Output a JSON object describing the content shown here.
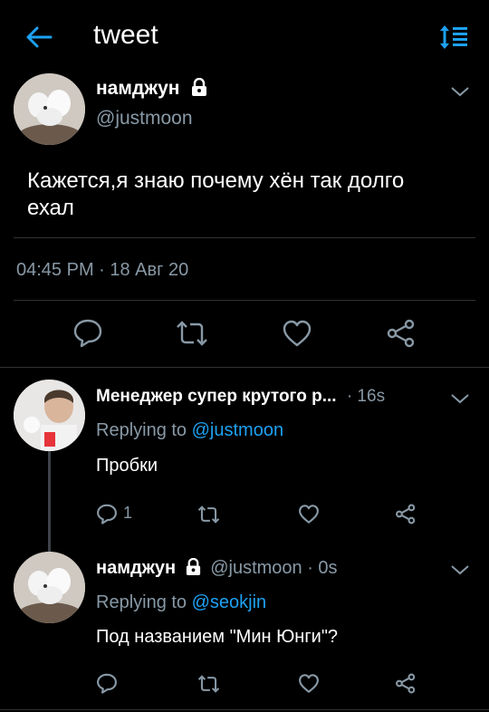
{
  "header": {
    "title": "tweet"
  },
  "main_tweet": {
    "name": "намджун",
    "handle": "@justmoon",
    "text_line1": "Кажется,я знаю почему хён так долго",
    "text_line2": "ехал",
    "timestamp": "04:45 PM · 18 Авг 20"
  },
  "replies": [
    {
      "name": "Менеджер супер крутого р...",
      "time": "· 16s",
      "replying_prefix": "Replying to",
      "replying_handle": "@justmoon",
      "text": "Пробки",
      "reply_count": "1"
    },
    {
      "name": "намджун",
      "handle_time": "@justmoon · 0s",
      "replying_prefix": "Replying to",
      "replying_handle": "@seokjin",
      "text": "Под названием \"Мин Юнги\"?"
    }
  ],
  "colors": {
    "accent": "#1da1f2",
    "muted": "#8899a6",
    "bg": "#000000",
    "divider": "#2f3336"
  },
  "icons": [
    "back-arrow-icon",
    "sort-icon",
    "lock-icon",
    "chevron-down-icon",
    "reply-icon",
    "retweet-icon",
    "like-icon",
    "share-icon"
  ]
}
